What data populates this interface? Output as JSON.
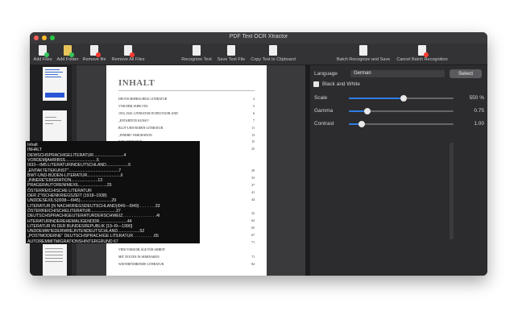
{
  "window": {
    "title": "PDF Text OCR Xtractor"
  },
  "colors": {
    "accent": "#2f7de1",
    "selection": "#2a56d6",
    "red": "#ff5f57",
    "yellow": "#febc2e",
    "green": "#28c840"
  },
  "toolbar": {
    "add_files": "Add Files",
    "add_folder": "Add Folder",
    "remove_file": "Remove file",
    "remove_all_files": "Remove All Files",
    "recognize_text": "Recognize Text",
    "save_text_file": "Save Text File",
    "copy_to_clipboard": "Copy Text to Clipboard",
    "batch_recognize_save": "Batch Recognize and Save",
    "cancel_batch": "Cancel Batch Recognition"
  },
  "document": {
    "heading": "INHALT",
    "toc": [
      {
        "t": "DEUTSCHSPRACHIGE LITERATUR",
        "p": "4"
      },
      {
        "t": "VOR DEM JAHR 1933",
        "p": "5"
      },
      {
        "t": "1933–1945: LITERATUR IN DEUTSCHLAND",
        "p": "6"
      },
      {
        "t": "„ENTARTETE KUNST“",
        "p": "7"
      },
      {
        "t": "BLUT-UND-BODEN-LITERATUR",
        "p": "11"
      },
      {
        "t": "„INNERE“ EMIGRATION",
        "p": "13"
      },
      {
        "t": "EXILLITERATUR",
        "p": "15"
      },
      {
        "t": "PRAGER AUTOREN IM EXIL",
        "p": "25"
      },
      {
        "t": "ÖSTERREICHISCHE LITERATUR",
        "p": ""
      },
      {
        "t": "DER ZWISCHENKRIEGSZEIT (1918–1938)",
        "p": ""
      },
      {
        "t": "UND DES EXILS (1938–1945)",
        "p": "29"
      },
      {
        "t": "LITERATUR IN NACHKRIEGSDEUTSCHLAND (1945–1949)",
        "p": "33"
      },
      {
        "t": "ÖSTERREICHISCHE LITERATUR",
        "p": "37"
      },
      {
        "t": "DEUTSCHSPRACHIGE LITERATUR DER SCHWEIZ",
        "p": "41"
      },
      {
        "t": "LITERATUR IN DER EHEMALIGEN DDR",
        "p": "44"
      },
      {
        "t": "LITERATUR IN DER BUNDESREPUBLIK (1949–1990)",
        "p": ""
      },
      {
        "t": "UND DEM WIEDERVEREINTEN DEUTSCHLAND",
        "p": "52"
      },
      {
        "t": "DRAMA UND THEATER",
        "p": "62"
      },
      {
        "t": "„POSTMODERNE“ DEUTSCHSPRACHIGE LITERATUR",
        "p": "65"
      },
      {
        "t": "AUTOREN MIT MIGRATIONSHINTERGRUND",
        "p": "67"
      },
      {
        "t": "ANHANG",
        "p": "71"
      },
      {
        "t": "VIER VORSCHLÄGE FÜR ARBEIT",
        "p": ""
      },
      {
        "t": "MIT TEXTEN IN SEMINAREN",
        "p": "71"
      },
      {
        "t": "WEITERFÜHRENDE LITERATUR",
        "p": "84"
      }
    ]
  },
  "settings": {
    "language_label": "Language",
    "language_value": "German",
    "select_button": "Select",
    "bw_label": "Black and White",
    "scale_label": "Scale",
    "scale_value": "550 %",
    "scale_level": 0.52,
    "gamma_label": "Gamma",
    "gamma_value": "0.75",
    "gamma_level": 0.18,
    "contrast_label": "Contrast",
    "contrast_value": "1.00",
    "contrast_level": 0.12
  },
  "ocr_lines": [
    "Inhalt",
    "INHALT",
    "DEWSCHSPRACHIGELITERATUR..........................4",
    "VORDEM]AHRIBSS...........................5",
    "I933—IM5:LITERATURINDEUTSCHLAND...................6",
    "„ENTAKTETEKUNST\"...........................................7",
    "BWT-UND-BÜDEN-LITERATUR.............................ll",
    "„INNERE\"E8IGRATION.......................13",
    "PRAGERAUTORENIMEXIL........................25",
    "ÖSTERREICHISCHE LITERATUR",
    "DER Z\"ISCHENKRIEGSZEIT (1918–1938)",
    "UNDDESEXILS(I938—I945)...........................29",
    "LITERATUR [N NACHKRIEGSDEUTSCHLAND(I945—I949) . . . . . . .33",
    "ÖSTERREICHISCHELITERATUR......................37",
    "DEUTSCHSPRACHIGEUTERATURDERSCHWEIZ. . . . . . . . . . . . . . .4l",
    "HTERATURINDEREHEMALIGENDDR........................44",
    "LITERATUR IN DER BUNDESREPUBLIK [19–I9—1990]",
    "UNDDEMW'IEDERWREJNTENDEUTSCHLAND...................52",
    "„POSTMODERNE\" DEUTSCHSPRACHIGE LITERATUR . . . . . . . . .65",
    "AUTOREMMITMIGRATIONSHINTERGRUND 67"
  ]
}
